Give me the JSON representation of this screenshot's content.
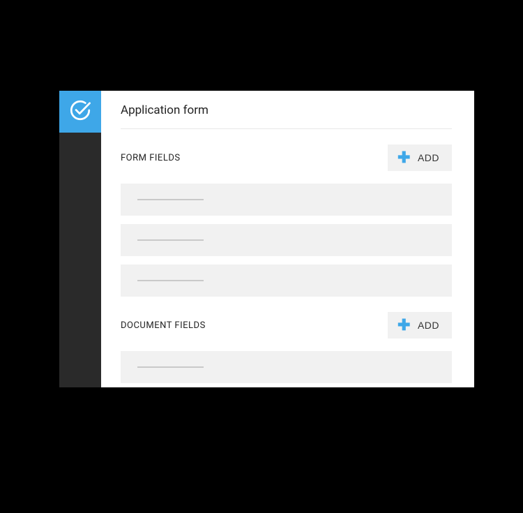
{
  "page": {
    "title": "Application form"
  },
  "sections": {
    "formFields": {
      "label": "FORM FIELDS",
      "addLabel": "ADD"
    },
    "documentFields": {
      "label": "DOCUMENT FIELDS",
      "addLabel": "ADD"
    }
  },
  "colors": {
    "accent": "#3ea7e8",
    "sidebar": "#2a2a2a",
    "muted": "#f1f1f1"
  }
}
